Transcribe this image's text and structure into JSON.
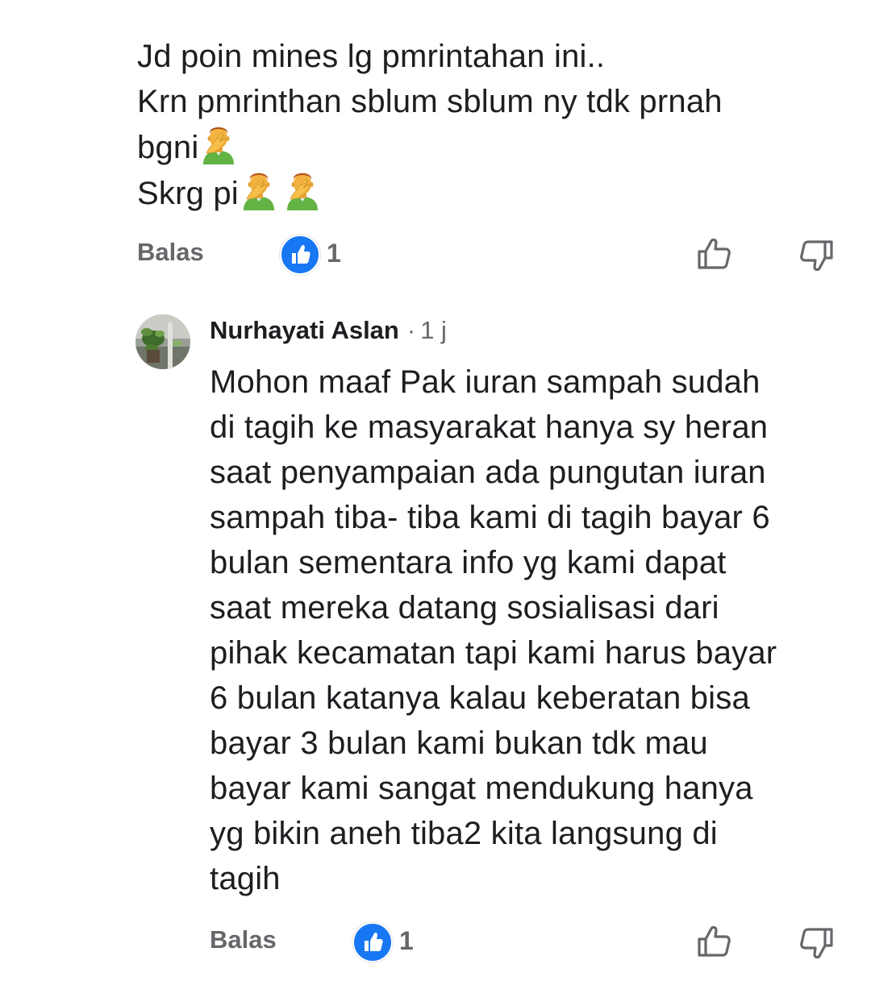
{
  "first_comment": {
    "lines": [
      "Jd poin mines lg pmrintahan ini..",
      "Krn pmrinthan sblum sblum ny tdk prnah",
      "bgni",
      "Skrg pi"
    ],
    "emoji_name": "man-facepalming-emoji",
    "reply_label": "Balas",
    "like_count": "1"
  },
  "second_comment": {
    "author": "Nurhayati Aslan",
    "separator": "·",
    "timestamp": "1 j",
    "lines": [
      "Mohon maaf Pak iuran sampah sudah",
      "di tagih ke masyarakat hanya sy heran",
      "saat penyampaian ada pungutan iuran",
      "sampah tiba- tiba kami di tagih bayar 6",
      "bulan sementara info yg kami dapat",
      "saat mereka datang sosialisasi dari",
      "pihak kecamatan tapi kami harus bayar",
      "6 bulan katanya kalau keberatan bisa",
      "bayar 3 bulan kami bukan tdk mau",
      "bayar kami sangat mendukung hanya",
      "yg bikin aneh tiba2 kita langsung di",
      "tagih"
    ],
    "reply_label": "Balas",
    "like_count": "1"
  },
  "colors": {
    "text": "#1c1e21",
    "secondary": "#65676b",
    "like_blue": "#1877f2",
    "emoji_skin": "#f3b23f",
    "emoji_shirt": "#62b344"
  },
  "icons": [
    "thumbs-up-icon",
    "thumbs-down-icon",
    "like-reaction-icon",
    "avatar-plant-photo"
  ]
}
